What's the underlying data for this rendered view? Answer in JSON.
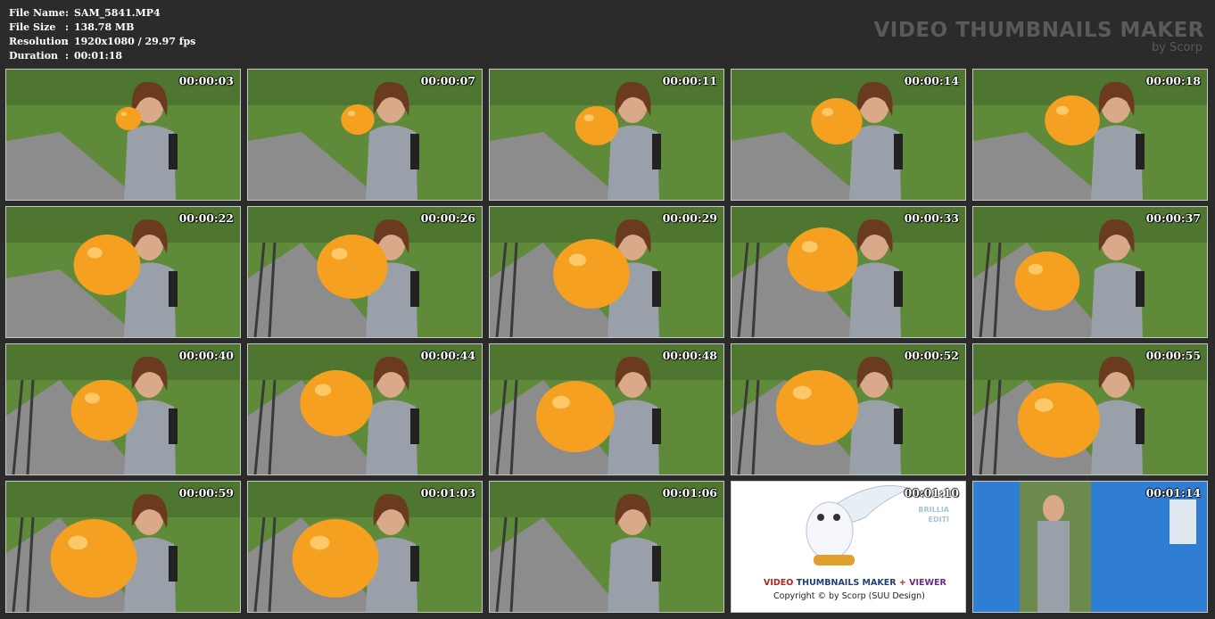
{
  "info": {
    "rows": [
      {
        "label": "File Name",
        "sep": ":",
        "value": "SAM_5841.MP4"
      },
      {
        "label": "File Size",
        "sep": ":",
        "value": "138.78 MB"
      },
      {
        "label": "Resolution",
        "sep": ":",
        "value": "1920x1080 / 29.97 fps"
      },
      {
        "label": "Duration",
        "sep": ":",
        "value": "00:01:18"
      }
    ]
  },
  "brand": {
    "title": "VIDEO THUMBNAILS MAKER",
    "subtitle": "by Scorp"
  },
  "thumbnails": [
    {
      "timestamp": "00:00:03"
    },
    {
      "timestamp": "00:00:07"
    },
    {
      "timestamp": "00:00:11"
    },
    {
      "timestamp": "00:00:14"
    },
    {
      "timestamp": "00:00:18"
    },
    {
      "timestamp": "00:00:22"
    },
    {
      "timestamp": "00:00:26"
    },
    {
      "timestamp": "00:00:29"
    },
    {
      "timestamp": "00:00:33"
    },
    {
      "timestamp": "00:00:37"
    },
    {
      "timestamp": "00:00:40"
    },
    {
      "timestamp": "00:00:44"
    },
    {
      "timestamp": "00:00:48"
    },
    {
      "timestamp": "00:00:52"
    },
    {
      "timestamp": "00:00:55"
    },
    {
      "timestamp": "00:00:59"
    },
    {
      "timestamp": "00:01:03"
    },
    {
      "timestamp": "00:01:06"
    },
    {
      "timestamp": "00:01:10"
    },
    {
      "timestamp": "00:01:14"
    }
  ],
  "splash": {
    "vtm_part1": "VIDEO ",
    "vtm_part2": "THUMBNAILS MAKER",
    "vtm_plus": " + ",
    "vtm_part3": "VIEWER",
    "copyright": "Copyright © by Scorp (SUU Design)",
    "side_1": "BRILLIA",
    "side_2": "EDITI"
  },
  "colors": {
    "background": "#2b2b2b",
    "balloon": "#f5a020",
    "grass": "#5f8a3a",
    "gravel": "#8c8c8c",
    "train_blue": "#2f7ed3"
  }
}
